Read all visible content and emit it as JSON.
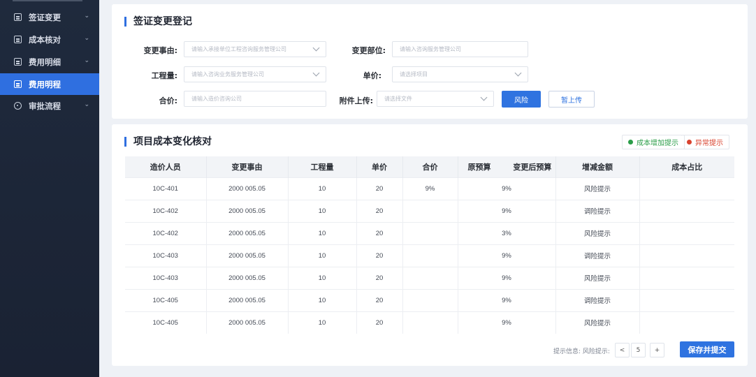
{
  "sidebar": {
    "items": [
      {
        "label": "签证变更",
        "icon": "document-icon"
      },
      {
        "label": "成本核对",
        "icon": "document-icon"
      },
      {
        "label": "费用明细",
        "icon": "document-icon"
      },
      {
        "label": "费用明程",
        "icon": "document-icon",
        "active": true
      },
      {
        "label": "审批流程",
        "icon": "clock-icon"
      }
    ]
  },
  "form": {
    "title": "签证变更登记",
    "fields": {
      "change_reason": {
        "label": "变更事由:",
        "placeholder": "请输入承接单位工程咨询服务管理公司"
      },
      "change_dept": {
        "label": "变更部位:",
        "placeholder": "请输入咨询服务管理公司"
      },
      "quantity": {
        "label": "工程量:",
        "placeholder": "请输入咨询业务服务管理公司"
      },
      "unit_price": {
        "label": "单价:",
        "placeholder": "请选择项目"
      },
      "total": {
        "label": "合价:",
        "placeholder": "请输入造价咨询公司"
      },
      "attachment": {
        "label": "附件上传:",
        "placeholder": "请选择文件"
      }
    },
    "buttons": {
      "primary": "风险",
      "upload": "暂上传"
    }
  },
  "review": {
    "title": "项目成本变化核对",
    "legend": {
      "increase": "成本增加提示",
      "abnormal": "异常提示"
    },
    "colors": {
      "increase": "#2a9d48",
      "abnormal": "#d9432f",
      "accent": "#2f73e0"
    },
    "columns": [
      "造价人员",
      "变更事由",
      "工程量",
      "单价",
      "合价",
      "原预算",
      "变更后预算",
      "增减金额",
      "成本占比"
    ],
    "rows": [
      {
        "staff": "10C-401",
        "reason": "2000 005.05",
        "qty": "10",
        "price": "20",
        "total": "9%",
        "budget": "9%",
        "delta": "风险提示",
        "tone": "red"
      },
      {
        "staff": "10C-402",
        "reason": "2000 005.05",
        "qty": "10",
        "price": "20",
        "total": "",
        "budget": "9%",
        "delta": "调险提示",
        "tone": "green"
      },
      {
        "staff": "10C-402",
        "reason": "2000 005.05",
        "qty": "10",
        "price": "20",
        "total": "",
        "budget": "3%",
        "delta": "风险提示",
        "tone": "green"
      },
      {
        "staff": "10C-403",
        "reason": "2000 005.05",
        "qty": "10",
        "price": "20",
        "total": "",
        "budget": "9%",
        "delta": "调险提示",
        "tone": "green"
      },
      {
        "staff": "10C-403",
        "reason": "2000 005.05",
        "qty": "10",
        "price": "20",
        "total": "",
        "budget": "9%",
        "delta": "风险提示",
        "tone": "green"
      },
      {
        "staff": "10C-405",
        "reason": "2000 005.05",
        "qty": "10",
        "price": "20",
        "total": "",
        "budget": "9%",
        "delta": "调险提示",
        "tone": "red"
      },
      {
        "staff": "10C-405",
        "reason": "2000 005.05",
        "qty": "10",
        "price": "20",
        "total": "",
        "budget": "9%",
        "delta": "风险提示",
        "tone": "red"
      }
    ],
    "pager": {
      "label": "提示信息: 风险提示:",
      "prev": "<",
      "page": "5",
      "next": "+"
    },
    "submit": "保存并提交"
  }
}
